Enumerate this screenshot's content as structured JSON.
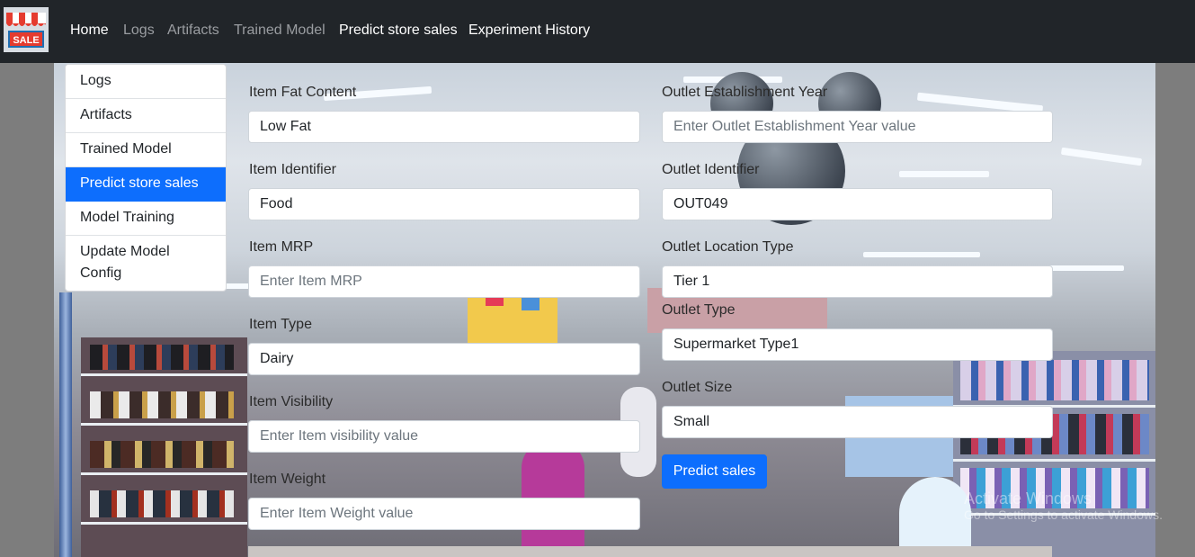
{
  "logo": {
    "text": "SALE"
  },
  "nav": {
    "items": [
      {
        "label": "Home",
        "style": "bright"
      },
      {
        "label": "Logs",
        "style": "dim"
      },
      {
        "label": "Artifacts",
        "style": "dim"
      },
      {
        "label": "Trained Model",
        "style": "dim"
      },
      {
        "label": "Predict store sales",
        "style": "bright"
      },
      {
        "label": "Experiment History",
        "style": "bright"
      }
    ]
  },
  "sidebar": {
    "items": [
      {
        "label": "Logs",
        "active": false
      },
      {
        "label": "Artifacts",
        "active": false
      },
      {
        "label": "Trained Model",
        "active": false
      },
      {
        "label": "Predict store sales",
        "active": true
      },
      {
        "label": "Model Training",
        "active": false
      },
      {
        "label": "Update Model Config",
        "active": false
      }
    ]
  },
  "form": {
    "item_fat_content": {
      "label": "Item Fat Content",
      "value": "Low Fat",
      "placeholder": ""
    },
    "item_identifier": {
      "label": "Item Identifier",
      "value": "Food",
      "placeholder": ""
    },
    "item_mrp": {
      "label": "Item MRP",
      "value": "",
      "placeholder": "Enter Item MRP"
    },
    "item_type": {
      "label": "Item Type",
      "value": "Dairy",
      "placeholder": ""
    },
    "item_visibility": {
      "label": "Item Visibility",
      "value": "",
      "placeholder": "Enter Item visibility value"
    },
    "item_weight": {
      "label": "Item Weight",
      "value": "",
      "placeholder": "Enter Item Weight value"
    },
    "outlet_establishment_year": {
      "label": "Outlet Establishment Year",
      "value": "",
      "placeholder": "Enter Outlet Establishment Year value"
    },
    "outlet_identifier": {
      "label": "Outlet Identifier",
      "value": "OUT049",
      "placeholder": ""
    },
    "outlet_location_type": {
      "label": "Outlet Location Type",
      "value": "Tier 1",
      "placeholder": ""
    },
    "outlet_type": {
      "label": "Outlet Type",
      "value": "Supermarket Type1",
      "placeholder": ""
    },
    "outlet_size": {
      "label": "Outlet Size",
      "value": "Small",
      "placeholder": ""
    },
    "submit_label": "Predict sales"
  },
  "watermark": {
    "line1": "Activate Windows",
    "line2": "Go to Settings to activate Windows."
  },
  "colors": {
    "navbar": "#212529",
    "primary": "#0d6efd",
    "nav_dim": "#9a9da1"
  }
}
